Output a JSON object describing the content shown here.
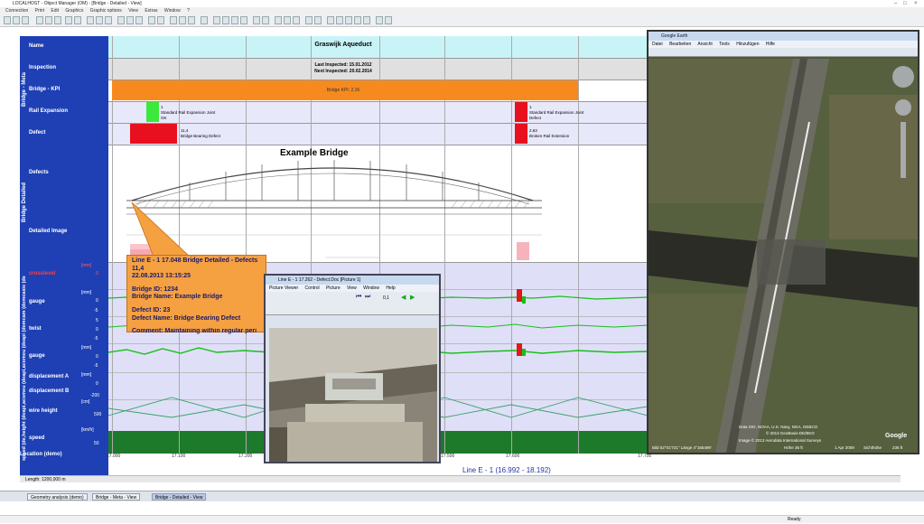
{
  "app": {
    "title": "LOCALHOST - Object Manager (OM) - [Bridge - Detailed - View]",
    "menu": [
      "Connection",
      "Print",
      "Edit",
      "Graphics",
      "Graphic options",
      "View",
      "Extras",
      "Window",
      "?"
    ]
  },
  "rows": {
    "name": "Name",
    "inspection": "Inspection",
    "kpi": "Bridge - KPI",
    "rail_expansion": "Rail Expansion",
    "defect": "Defect",
    "defects": "Defects",
    "detailed_image": "Detailed Image",
    "crosslevel": "crosslevel",
    "gauge": "gauge",
    "twist": "twist",
    "gauge2": "gauge",
    "displacement_a": "displacement A",
    "displacement_b": "displacement B",
    "wire_height": "wire height",
    "speed": "speed",
    "location": "Location (demo)"
  },
  "group_labels": {
    "bridge_meta": "Bridge - Meta",
    "bridge_detailed": "Bridge Detailed",
    "measurements": "speed (de,height (deapi,acemeu (deapi,acemeu (deapi (demcam (demcasie (de"
  },
  "scales": {
    "mm": "[mm]",
    "cm": "[cm]",
    "kmh": "[km/h]",
    "v0": "0",
    "v5": "5",
    "vm5": "-5",
    "v500": "500",
    "v50": "50",
    "vm200": "-200"
  },
  "bridge": {
    "name": "Graswijk Aqueduct",
    "last_inspected": "Last Inspected: 15.01.2012",
    "next_inspected": "Next Inspected: 20.02.2014",
    "kpi": "Bridge KPI: 2,16",
    "drawing_title": "Example Bridge"
  },
  "rail_expansion": {
    "left_value": "1",
    "left_name": "Standard Rail Expansion Joint",
    "left_status": "OK",
    "right_value": "1",
    "right_name": "Standard Rail Expansion Joint",
    "right_status": "Defect"
  },
  "defects": {
    "left_value": "11,4",
    "left_name": "Bridge Bearing Defect",
    "right_value": "2,63",
    "right_name": "Broken Rail Extension"
  },
  "popup": {
    "line1": "Line E - 1 17.048 Bridge Detailed - Defects",
    "line2": "11,4",
    "line3": "22.08.2013 13:15:25",
    "line4": "Bridge ID: 1234",
    "line5": "Bridge Name: Example Bridge",
    "line6": "Defect ID: 23",
    "line7": "Defect Name: Bridge Bearing Defect",
    "line8": "Comment: Maintaining within regular peri"
  },
  "axis": {
    "ticks": [
      "17.000",
      "17.100",
      "17.200",
      "17.500",
      "17.600",
      "17.700"
    ],
    "range": "Line E - 1 (16.992 - 18.192)"
  },
  "length": "Length: 1200,000 m",
  "tasks": [
    "Geometry analysis (demo)",
    "Bridge - Meta - View",
    "Bridge - Detailed - View"
  ],
  "status": {
    "ready": "Ready"
  },
  "ge": {
    "title": "Google Earth",
    "menu": [
      "Datei",
      "Bearbeiten",
      "Ansicht",
      "Tools",
      "Hinzufügen",
      "Hilfe"
    ],
    "credits": "Data SIO, NOAA, U.S. Navy, NGA, GEBCO",
    "credits2": "© 2013 GeoBasis-DE/BKG",
    "credits3": "Image © 2013 Aerodata International Surveys",
    "logo": "Google",
    "coords": "Bild 52°01'721\"  Länge  4°165499'",
    "height": "Höhe  36 ft",
    "date": "1 Apr 2009",
    "view": "Sichthöhe",
    "alt": "236 ft"
  },
  "pv": {
    "title": "Line E - 1 17.262 - Defect.Doc [Picture 1]",
    "menu": [
      "Picture Viewer",
      "Control",
      "Picture",
      "View",
      "Window",
      "Help"
    ],
    "zoom": "0,1"
  }
}
